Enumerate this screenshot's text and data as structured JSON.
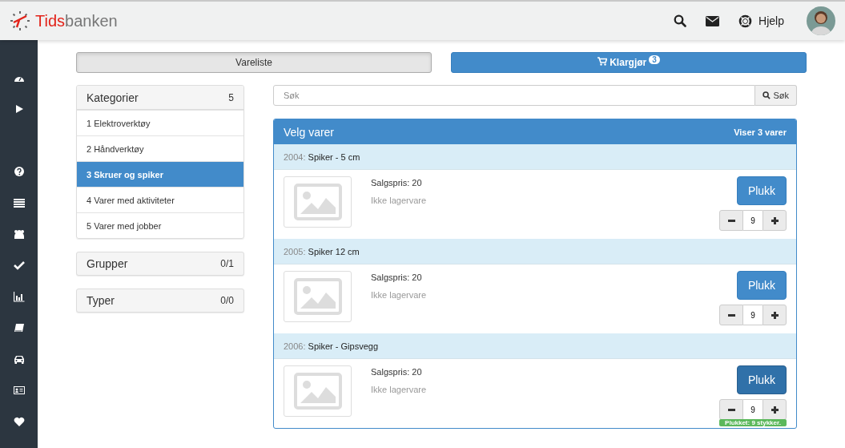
{
  "header": {
    "logo_red": "Tids",
    "logo_grey": "banken",
    "help": "Hjelp"
  },
  "tabs": [
    {
      "label": "Vareliste",
      "selected": true
    },
    {
      "label": "Klargjør",
      "selected": false,
      "badge": "3"
    }
  ],
  "categories": {
    "title": "Kategorier",
    "count": "5",
    "items": [
      {
        "label": "1 Elektroverktøy",
        "selected": false
      },
      {
        "label": "2 Håndverktøy",
        "selected": false
      },
      {
        "label": "3 Skruer og spiker",
        "selected": true
      },
      {
        "label": "4 Varer med aktiviteter",
        "selected": false
      },
      {
        "label": "5 Varer med jobber",
        "selected": false
      }
    ]
  },
  "panels": [
    {
      "title": "Grupper",
      "count": "0/1"
    },
    {
      "title": "Typer",
      "count": "0/0"
    }
  ],
  "search": {
    "placeholder": "Søk",
    "button": "Søk"
  },
  "products": {
    "title": "Velg varer",
    "summary": "Viser 3 varer",
    "items": [
      {
        "code": "2004:",
        "name": "Spiker - 5 cm",
        "price": "Salgspris: 20",
        "stock": "Ikke lagervare",
        "button": "Plukk",
        "quantity": "9",
        "picked": false
      },
      {
        "code": "2005:",
        "name": "Spiker 12 cm",
        "price": "Salgspris: 20",
        "stock": "Ikke lagervare",
        "button": "Plukk",
        "quantity": "9",
        "picked": false
      },
      {
        "code": "2006:",
        "name": "Spiker - Gipsvegg",
        "price": "Salgspris: 20",
        "stock": "Ikke lagervare",
        "button": "Plukk",
        "quantity": "9",
        "picked": true,
        "picked_note": "Plukket: 9 stykker."
      }
    ]
  }
}
